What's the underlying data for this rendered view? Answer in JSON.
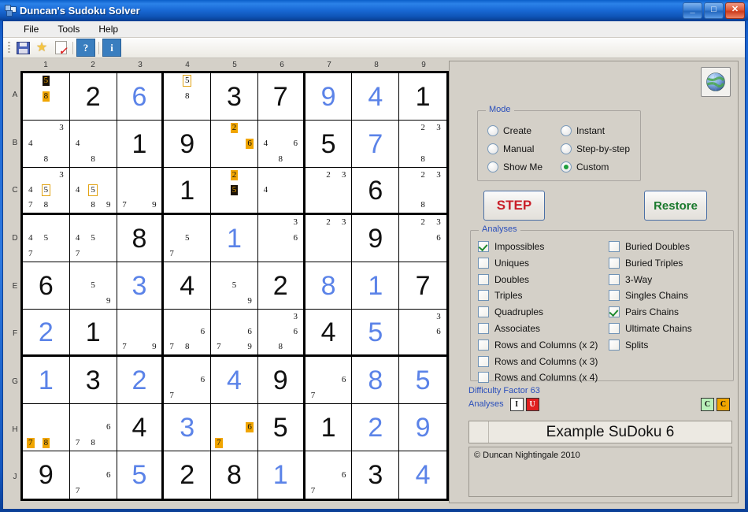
{
  "window": {
    "title": "Duncan's Sudoku Solver",
    "icon": "app-icon",
    "minimize": "_",
    "maximize": "□",
    "close": "✕"
  },
  "menubar": {
    "items": [
      {
        "label": "File"
      },
      {
        "label": "Tools"
      },
      {
        "label": "Help"
      }
    ]
  },
  "toolbar": {
    "items": [
      {
        "name": "save-icon",
        "label": ""
      },
      {
        "name": "star-icon",
        "label": "★"
      },
      {
        "name": "new-check-icon",
        "label": ""
      },
      {
        "name": "help-icon",
        "label": "?"
      },
      {
        "name": "info-icon",
        "label": "i"
      }
    ]
  },
  "board": {
    "column_labels": [
      "1",
      "2",
      "3",
      "4",
      "5",
      "6",
      "7",
      "8",
      "9"
    ],
    "row_labels": [
      "A",
      "B",
      "C",
      "D",
      "E",
      "F",
      "G",
      "H",
      "J"
    ],
    "cells": [
      [
        {
          "pencil": [
            {
              "d": "5",
              "pos": 2,
              "style": "dk"
            },
            {
              "d": "8",
              "pos": 5,
              "style": "hl"
            }
          ]
        },
        {
          "value": "2",
          "kind": "given"
        },
        {
          "value": "6",
          "kind": "solved"
        },
        {
          "pencil": [
            {
              "d": "5",
              "pos": 2,
              "style": "box"
            },
            {
              "d": "8",
              "pos": 5,
              "style": "plain"
            }
          ]
        },
        {
          "value": "3",
          "kind": "given"
        },
        {
          "value": "7",
          "kind": "given"
        },
        {
          "value": "9",
          "kind": "solved"
        },
        {
          "value": "4",
          "kind": "solved"
        },
        {
          "value": "1",
          "kind": "given"
        }
      ],
      [
        {
          "pencil": [
            {
              "d": "3",
              "pos": 3,
              "style": "plain"
            },
            {
              "d": "4",
              "pos": 4,
              "style": "plain"
            },
            {
              "d": "8",
              "pos": 8,
              "style": "plain"
            }
          ]
        },
        {
          "pencil": [
            {
              "d": "4",
              "pos": 4,
              "style": "plain"
            },
            {
              "d": "8",
              "pos": 8,
              "style": "plain"
            }
          ]
        },
        {
          "value": "1",
          "kind": "given"
        },
        {
          "value": "9",
          "kind": "given"
        },
        {
          "pencil": [
            {
              "d": "2",
              "pos": 2,
              "style": "hl"
            },
            {
              "d": "6",
              "pos": 6,
              "style": "hl"
            }
          ]
        },
        {
          "pencil": [
            {
              "d": "4",
              "pos": 4,
              "style": "plain"
            },
            {
              "d": "6",
              "pos": 6,
              "style": "plain"
            },
            {
              "d": "8",
              "pos": 8,
              "style": "plain"
            }
          ]
        },
        {
          "value": "5",
          "kind": "given"
        },
        {
          "value": "7",
          "kind": "solved"
        },
        {
          "pencil": [
            {
              "d": "2",
              "pos": 2,
              "style": "plain"
            },
            {
              "d": "3",
              "pos": 3,
              "style": "plain"
            },
            {
              "d": "8",
              "pos": 8,
              "style": "plain"
            }
          ]
        }
      ],
      [
        {
          "pencil": [
            {
              "d": "3",
              "pos": 3,
              "style": "plain"
            },
            {
              "d": "4",
              "pos": 4,
              "style": "plain"
            },
            {
              "d": "5",
              "pos": 5,
              "style": "box"
            },
            {
              "d": "7",
              "pos": 7,
              "style": "plain"
            },
            {
              "d": "8",
              "pos": 8,
              "style": "plain"
            }
          ]
        },
        {
          "pencil": [
            {
              "d": "4",
              "pos": 4,
              "style": "plain"
            },
            {
              "d": "5",
              "pos": 5,
              "style": "box"
            },
            {
              "d": "8",
              "pos": 8,
              "style": "plain"
            },
            {
              "d": "9",
              "pos": 9,
              "style": "plain"
            }
          ]
        },
        {
          "pencil": [
            {
              "d": "7",
              "pos": 7,
              "style": "plain"
            },
            {
              "d": "9",
              "pos": 9,
              "style": "plain"
            }
          ]
        },
        {
          "value": "1",
          "kind": "given"
        },
        {
          "pencil": [
            {
              "d": "2",
              "pos": 2,
              "style": "hl"
            },
            {
              "d": "5",
              "pos": 5,
              "style": "dk"
            }
          ]
        },
        {
          "pencil": [
            {
              "d": "4",
              "pos": 4,
              "style": "plain"
            }
          ]
        },
        {
          "pencil": [
            {
              "d": "2",
              "pos": 2,
              "style": "plain"
            },
            {
              "d": "3",
              "pos": 3,
              "style": "plain"
            }
          ]
        },
        {
          "value": "6",
          "kind": "given"
        },
        {
          "pencil": [
            {
              "d": "2",
              "pos": 2,
              "style": "plain"
            },
            {
              "d": "3",
              "pos": 3,
              "style": "plain"
            },
            {
              "d": "8",
              "pos": 8,
              "style": "plain"
            }
          ]
        }
      ],
      [
        {
          "pencil": [
            {
              "d": "4",
              "pos": 4,
              "style": "plain"
            },
            {
              "d": "5",
              "pos": 5,
              "style": "plain"
            },
            {
              "d": "7",
              "pos": 7,
              "style": "plain"
            }
          ]
        },
        {
          "pencil": [
            {
              "d": "4",
              "pos": 4,
              "style": "plain"
            },
            {
              "d": "5",
              "pos": 5,
              "style": "plain"
            },
            {
              "d": "7",
              "pos": 7,
              "style": "plain"
            }
          ]
        },
        {
          "value": "8",
          "kind": "given"
        },
        {
          "pencil": [
            {
              "d": "5",
              "pos": 5,
              "style": "plain"
            },
            {
              "d": "7",
              "pos": 7,
              "style": "plain"
            }
          ]
        },
        {
          "value": "1",
          "kind": "solved"
        },
        {
          "pencil": [
            {
              "d": "3",
              "pos": 3,
              "style": "plain"
            },
            {
              "d": "6",
              "pos": 6,
              "style": "plain"
            }
          ]
        },
        {
          "pencil": [
            {
              "d": "2",
              "pos": 2,
              "style": "plain"
            },
            {
              "d": "3",
              "pos": 3,
              "style": "plain"
            }
          ]
        },
        {
          "value": "9",
          "kind": "given"
        },
        {
          "pencil": [
            {
              "d": "2",
              "pos": 2,
              "style": "plain"
            },
            {
              "d": "3",
              "pos": 3,
              "style": "plain"
            },
            {
              "d": "6",
              "pos": 6,
              "style": "plain"
            }
          ]
        }
      ],
      [
        {
          "value": "6",
          "kind": "given"
        },
        {
          "pencil": [
            {
              "d": "5",
              "pos": 5,
              "style": "plain"
            },
            {
              "d": "9",
              "pos": 9,
              "style": "plain"
            }
          ]
        },
        {
          "value": "3",
          "kind": "solved"
        },
        {
          "value": "4",
          "kind": "given"
        },
        {
          "pencil": [
            {
              "d": "5",
              "pos": 5,
              "style": "plain"
            },
            {
              "d": "9",
              "pos": 9,
              "style": "plain"
            }
          ]
        },
        {
          "value": "2",
          "kind": "given"
        },
        {
          "value": "8",
          "kind": "solved"
        },
        {
          "value": "1",
          "kind": "solved"
        },
        {
          "value": "7",
          "kind": "given"
        }
      ],
      [
        {
          "value": "2",
          "kind": "solved"
        },
        {
          "value": "1",
          "kind": "given"
        },
        {
          "pencil": [
            {
              "d": "7",
              "pos": 7,
              "style": "plain"
            },
            {
              "d": "9",
              "pos": 9,
              "style": "plain"
            }
          ]
        },
        {
          "pencil": [
            {
              "d": "6",
              "pos": 6,
              "style": "plain"
            },
            {
              "d": "7",
              "pos": 7,
              "style": "plain"
            },
            {
              "d": "8",
              "pos": 8,
              "style": "plain"
            }
          ]
        },
        {
          "pencil": [
            {
              "d": "6",
              "pos": 6,
              "style": "plain"
            },
            {
              "d": "7",
              "pos": 7,
              "style": "plain"
            },
            {
              "d": "9",
              "pos": 9,
              "style": "plain"
            }
          ]
        },
        {
          "pencil": [
            {
              "d": "3",
              "pos": 3,
              "style": "plain"
            },
            {
              "d": "6",
              "pos": 6,
              "style": "plain"
            },
            {
              "d": "8",
              "pos": 8,
              "style": "plain"
            }
          ]
        },
        {
          "value": "4",
          "kind": "given"
        },
        {
          "value": "5",
          "kind": "solved"
        },
        {
          "pencil": [
            {
              "d": "3",
              "pos": 3,
              "style": "plain"
            },
            {
              "d": "6",
              "pos": 6,
              "style": "plain"
            }
          ]
        }
      ],
      [
        {
          "value": "1",
          "kind": "solved"
        },
        {
          "value": "3",
          "kind": "given"
        },
        {
          "value": "2",
          "kind": "solved"
        },
        {
          "pencil": [
            {
              "d": "6",
              "pos": 6,
              "style": "plain"
            },
            {
              "d": "7",
              "pos": 7,
              "style": "plain"
            }
          ]
        },
        {
          "value": "4",
          "kind": "solved"
        },
        {
          "value": "9",
          "kind": "given"
        },
        {
          "pencil": [
            {
              "d": "6",
              "pos": 6,
              "style": "plain"
            },
            {
              "d": "7",
              "pos": 7,
              "style": "plain"
            }
          ]
        },
        {
          "value": "8",
          "kind": "solved"
        },
        {
          "value": "5",
          "kind": "solved"
        }
      ],
      [
        {
          "pencil": [
            {
              "d": "7",
              "pos": 7,
              "style": "hl"
            },
            {
              "d": "8",
              "pos": 8,
              "style": "hl"
            }
          ]
        },
        {
          "pencil": [
            {
              "d": "6",
              "pos": 6,
              "style": "plain"
            },
            {
              "d": "7",
              "pos": 7,
              "style": "plain"
            },
            {
              "d": "8",
              "pos": 8,
              "style": "plain"
            }
          ]
        },
        {
          "value": "4",
          "kind": "given"
        },
        {
          "value": "3",
          "kind": "solved"
        },
        {
          "pencil": [
            {
              "d": "6",
              "pos": 6,
              "style": "hl"
            },
            {
              "d": "7",
              "pos": 7,
              "style": "hl"
            }
          ]
        },
        {
          "value": "5",
          "kind": "given"
        },
        {
          "value": "1",
          "kind": "given"
        },
        {
          "value": "2",
          "kind": "solved"
        },
        {
          "value": "9",
          "kind": "solved"
        }
      ],
      [
        {
          "value": "9",
          "kind": "given"
        },
        {
          "pencil": [
            {
              "d": "6",
              "pos": 6,
              "style": "plain"
            },
            {
              "d": "7",
              "pos": 7,
              "style": "plain"
            }
          ]
        },
        {
          "value": "5",
          "kind": "solved"
        },
        {
          "value": "2",
          "kind": "given"
        },
        {
          "value": "8",
          "kind": "given"
        },
        {
          "value": "1",
          "kind": "solved"
        },
        {
          "pencil": [
            {
              "d": "6",
              "pos": 6,
              "style": "plain"
            },
            {
              "d": "7",
              "pos": 7,
              "style": "plain"
            }
          ]
        },
        {
          "value": "3",
          "kind": "given"
        },
        {
          "value": "4",
          "kind": "solved"
        }
      ]
    ]
  },
  "panel": {
    "globe_button": "globe-icon",
    "mode": {
      "legend": "Mode",
      "options": [
        {
          "label": "Create",
          "selected": false
        },
        {
          "label": "Manual",
          "selected": false
        },
        {
          "label": "Show Me",
          "selected": false
        },
        {
          "label": "Instant",
          "selected": false
        },
        {
          "label": "Step-by-step",
          "selected": false
        },
        {
          "label": "Custom",
          "selected": true
        }
      ]
    },
    "step_button": "STEP",
    "restore_button": "Restore",
    "analyses": {
      "legend": "Analyses",
      "left_column": [
        {
          "label": "Impossibles",
          "checked": true
        },
        {
          "label": "Uniques",
          "checked": false
        },
        {
          "label": "Doubles",
          "checked": false
        },
        {
          "label": "Triples",
          "checked": false
        },
        {
          "label": "Quadruples",
          "checked": false
        },
        {
          "label": "Associates",
          "checked": false
        },
        {
          "label": "Rows and Columns (x 2)",
          "checked": false
        },
        {
          "label": "Rows and Columns (x 3)",
          "checked": false
        },
        {
          "label": "Rows and Columns (x 4)",
          "checked": false
        }
      ],
      "right_column": [
        {
          "label": "Buried Doubles",
          "checked": false
        },
        {
          "label": "Buried Triples",
          "checked": false
        },
        {
          "label": "3-Way",
          "checked": false
        },
        {
          "label": "Singles Chains",
          "checked": false
        },
        {
          "label": "Pairs Chains",
          "checked": true
        },
        {
          "label": "Ultimate Chains",
          "checked": false
        },
        {
          "label": "Splits",
          "checked": false
        }
      ]
    },
    "status": {
      "difficulty": "Difficulty Factor 63",
      "analyses_label": "Analyses",
      "badges_left": [
        {
          "text": "I",
          "style": "w"
        },
        {
          "text": "U",
          "style": "r"
        }
      ],
      "badges_right": [
        {
          "text": "C",
          "style": "g"
        },
        {
          "text": "C",
          "style": "o"
        }
      ]
    },
    "puzzle_name": "Example SuDoku 6",
    "notes": "© Duncan Nightingale 2010"
  }
}
